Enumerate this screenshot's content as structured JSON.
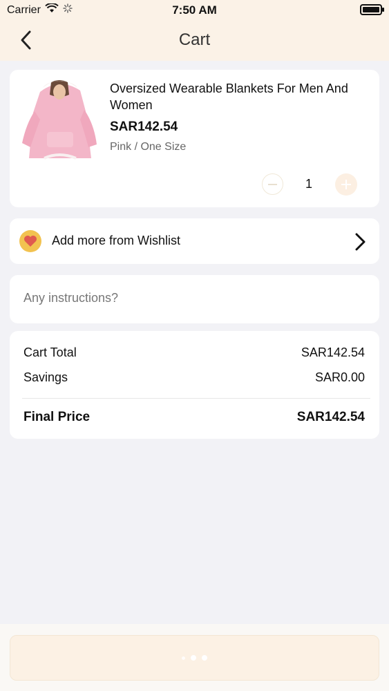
{
  "status_bar": {
    "carrier": "Carrier",
    "time": "7:50 AM"
  },
  "header": {
    "title": "Cart"
  },
  "cart_item": {
    "name": "Oversized Wearable Blankets For Men And Women",
    "price": "SAR142.54",
    "variant": "Pink / One Size",
    "quantity": "1"
  },
  "wishlist": {
    "label": "Add more from Wishlist"
  },
  "instructions": {
    "placeholder": "Any instructions?"
  },
  "summary": {
    "cart_total_label": "Cart Total",
    "cart_total_value": "SAR142.54",
    "savings_label": "Savings",
    "savings_value": "SAR0.00",
    "final_price_label": "Final Price",
    "final_price_value": "SAR142.54"
  },
  "colors": {
    "header_bg": "#fbf2e7",
    "page_bg": "#f2f2f6",
    "wishlist_icon_bg": "#f2c250",
    "heart": "#e05a4f",
    "button_bg": "#fcf1e4"
  }
}
